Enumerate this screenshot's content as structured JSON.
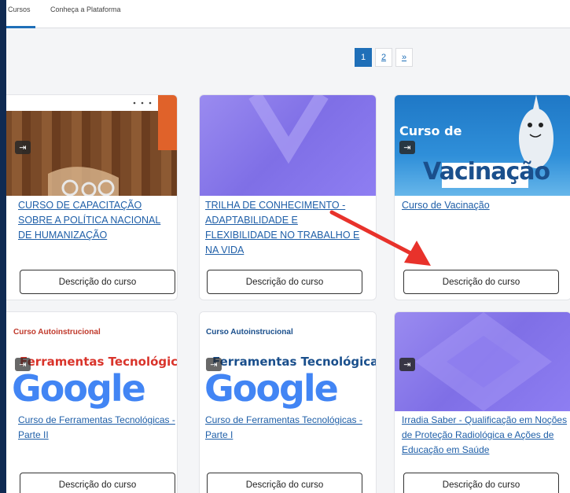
{
  "tabs": [
    {
      "label": "Cursos"
    },
    {
      "label": "Conheça a Plataforma"
    }
  ],
  "pager": {
    "pages": [
      "1",
      "2"
    ],
    "next": "»",
    "current": "1"
  },
  "cards": [
    {
      "title": "CURSO DE CAPACITAÇÃO SOBRE A POLÍTICA NACIONAL DE HUMANIZAÇÃO",
      "button": "Descrição do curso"
    },
    {
      "title": "TRILHA DE CONHECIMENTO - ADAPTABILIDADE E FLEXIBILIDADE NO TRABALHO E NA VIDA",
      "button": "Descrição do curso"
    },
    {
      "title": "Curso de Vacinação",
      "button": "Descrição do curso",
      "thumb_text_top": "Curso de",
      "thumb_text_main": "Vacinação"
    },
    {
      "title": "Curso de Ferramentas Tecnológicas - Parte II",
      "button": "Descrição do curso",
      "thumb_tag": "Curso Autoinstrucional",
      "thumb_heading": "Ferramentas Tecnológicas",
      "thumb_logo": "Google"
    },
    {
      "title": "Curso de Ferramentas Tecnológicas - Parte I",
      "button": "Descrição do curso",
      "thumb_tag": "Curso Autoinstrucional",
      "thumb_heading": "Ferramentas Tecnológicas",
      "thumb_logo": "Google"
    },
    {
      "title": "Irradia Saber - Qualificação em Noções de Proteção Radiológica e Ações de Educação em Saúde",
      "button": "Descrição do curso"
    }
  ],
  "colors": {
    "link": "#1f5fa8",
    "accent": "#1f6fb8",
    "arrow": "#e8322b",
    "frame": "#0f2a52"
  },
  "icons": {
    "enroll": "sign-in-icon",
    "annotation": "red-arrow-annotation"
  }
}
